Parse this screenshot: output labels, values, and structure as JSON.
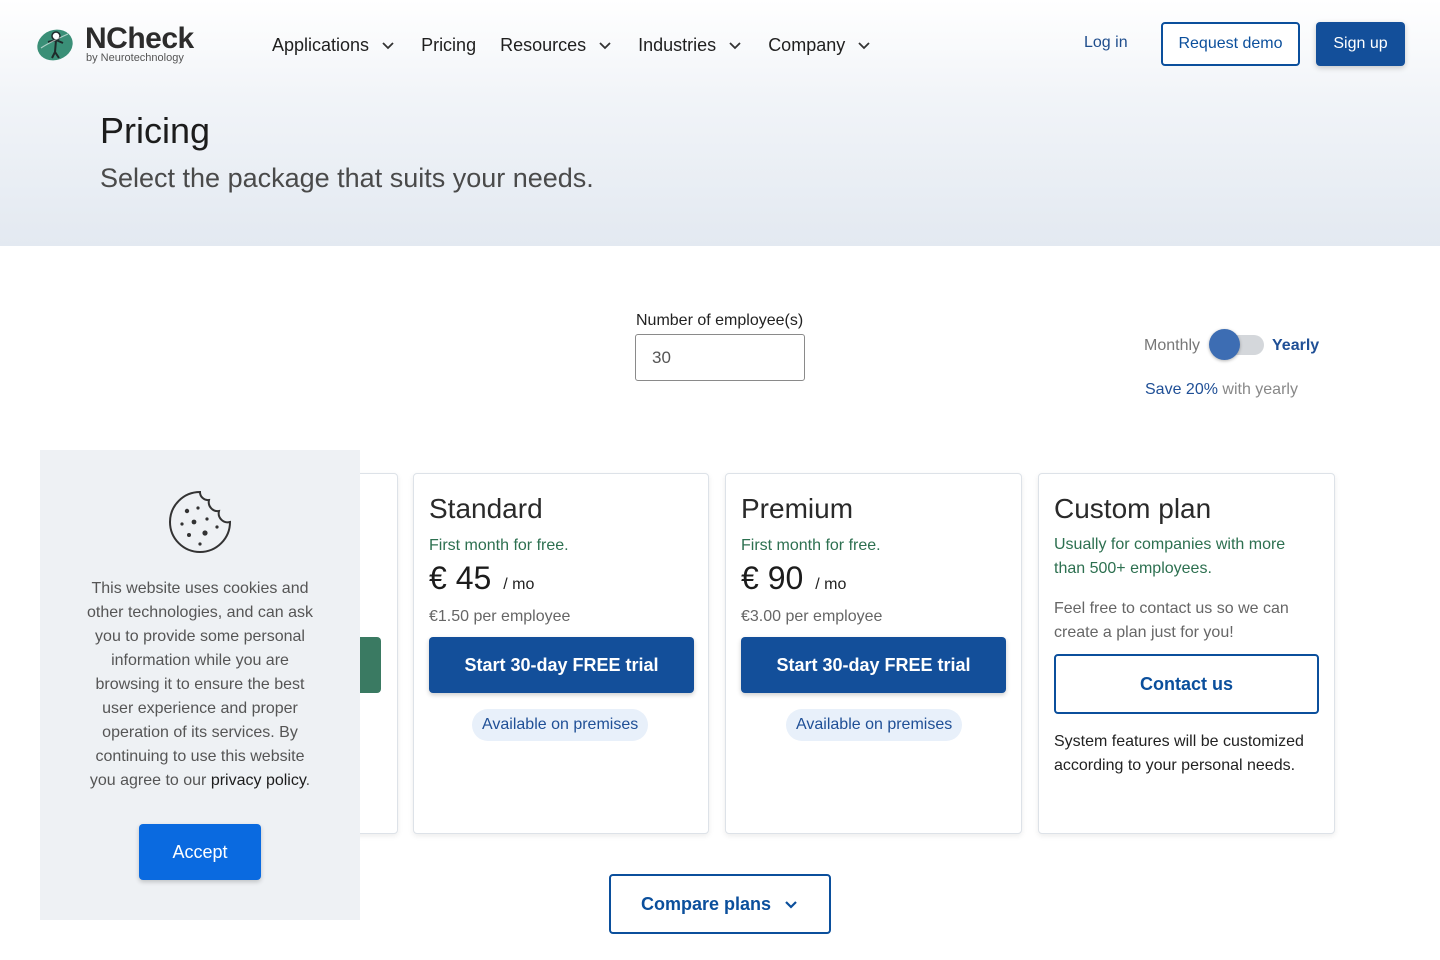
{
  "brand": {
    "name": "NCheck",
    "tagline": "by Neurotechnology"
  },
  "nav": {
    "items": [
      {
        "label": "Applications",
        "has_dropdown": true
      },
      {
        "label": "Pricing",
        "has_dropdown": false
      },
      {
        "label": "Resources",
        "has_dropdown": true
      },
      {
        "label": "Industries",
        "has_dropdown": true
      },
      {
        "label": "Company",
        "has_dropdown": true
      }
    ],
    "login": "Log in",
    "request_demo": "Request demo",
    "signup": "Sign up"
  },
  "hero": {
    "title": "Pricing",
    "subtitle": "Select the package that suits your needs."
  },
  "employees": {
    "label": "Number of employee(s)",
    "value": "30"
  },
  "billing": {
    "monthly": "Monthly",
    "yearly": "Yearly",
    "selected": "Yearly",
    "save_prefix": "Save 20%",
    "save_suffix": " with yearly"
  },
  "plans": {
    "standard": {
      "name": "Standard",
      "free_note": "First month for free.",
      "price": "€ 45",
      "period": "/ mo",
      "per_employee": "€1.50 per employee",
      "cta": "Start 30-day FREE trial",
      "badge": "Available on premises"
    },
    "premium": {
      "name": "Premium",
      "free_note": "First month for free.",
      "price": "€ 90",
      "period": "/ mo",
      "per_employee": "€3.00 per employee",
      "cta": "Start 30-day FREE trial",
      "badge": "Available on premises"
    },
    "custom": {
      "name": "Custom plan",
      "desc": "Usually for companies with more than 500+ employees.",
      "desc2": "Feel free to contact us so we can create a plan just for you!",
      "cta": "Contact us",
      "note": "System features will be customized according to your personal needs."
    }
  },
  "compare": {
    "label": "Compare plans"
  },
  "cookie": {
    "text": "This website uses cookies and other technologies, and can ask you to provide some personal information while you are browsing it to ensure the best user experience and proper operation of its services. By continuing to use this website you agree to our ",
    "link": "privacy policy",
    "end": ".",
    "accept": "Accept"
  },
  "colors": {
    "primary": "#134f9a",
    "accent_green": "#2d7050",
    "accept_blue": "#0a6ae0"
  }
}
